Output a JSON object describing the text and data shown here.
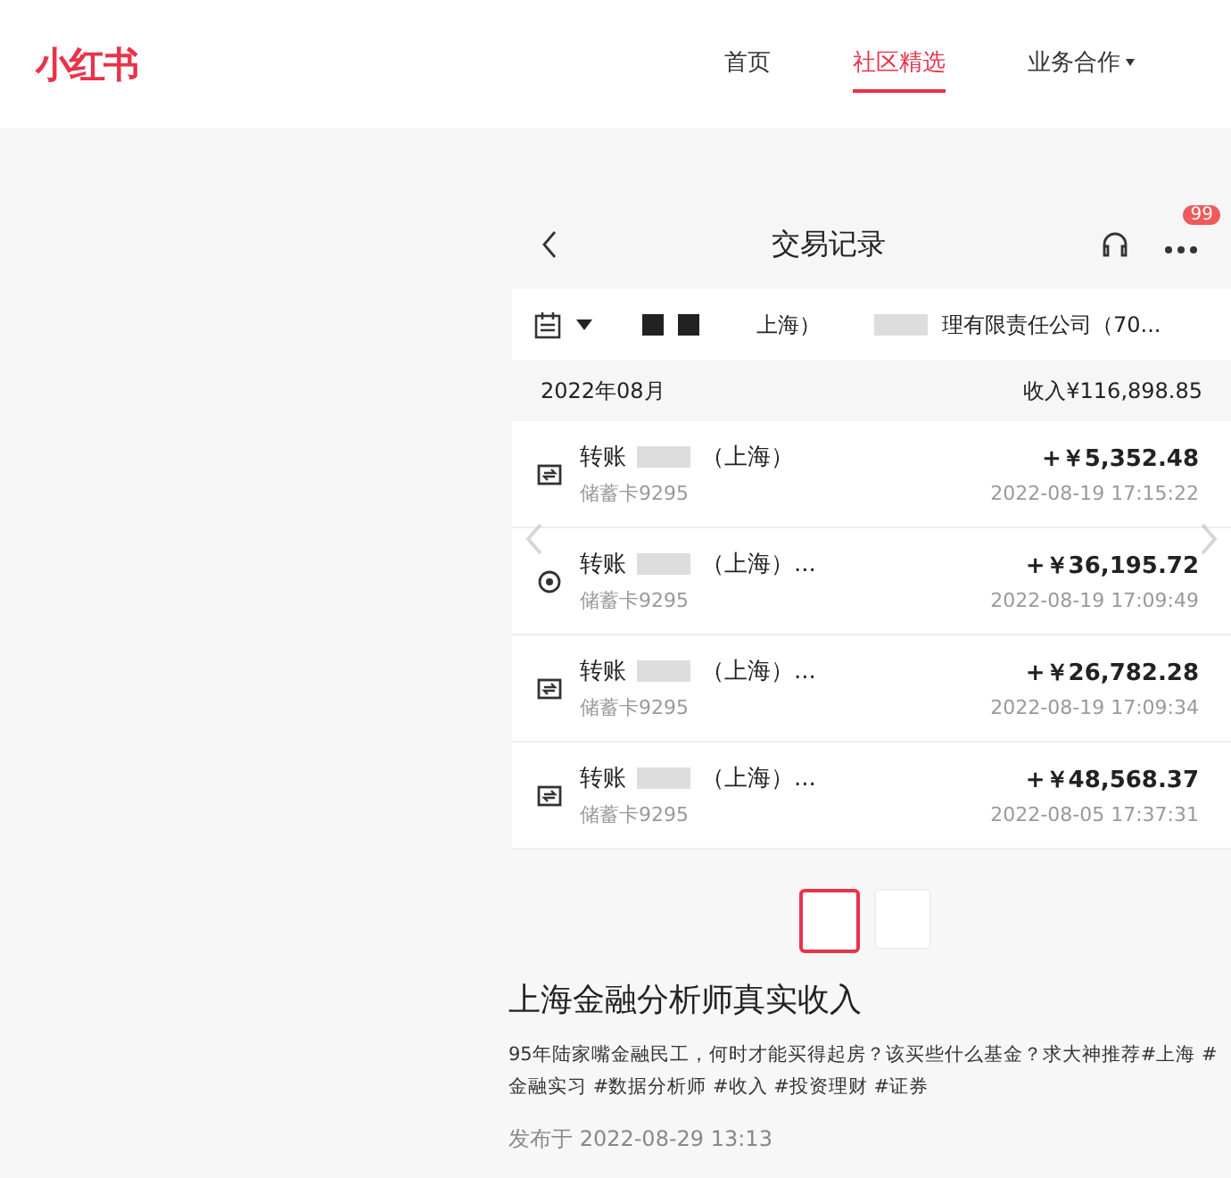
{
  "header": {
    "logo": "小红书",
    "nav": [
      {
        "label": "首页",
        "selected": false,
        "dropdown": false
      },
      {
        "label": "社区精选",
        "selected": true,
        "dropdown": false
      },
      {
        "label": "业务合作",
        "selected": false,
        "dropdown": true
      }
    ]
  },
  "screenshot": {
    "title": "交易记录",
    "badge": "99",
    "filter": {
      "part_1": "上海）",
      "part_2": "理有限责任公司（70..."
    },
    "month": "2022年08月",
    "income": "收入¥116,898.85",
    "rows": [
      {
        "kind": "transfer",
        "label": "转账",
        "detail": "（上海）",
        "card": "储蓄卡9295",
        "amount": "+￥5,352.48",
        "time": "2022-08-19 17:15:22"
      },
      {
        "kind": "circle",
        "label": "转账",
        "detail": "（上海）...",
        "card": "储蓄卡9295",
        "amount": "+￥36,195.72",
        "time": "2022-08-19 17:09:49"
      },
      {
        "kind": "transfer",
        "label": "转账",
        "detail": "（上海）...",
        "card": "储蓄卡9295",
        "amount": "+￥26,782.28",
        "time": "2022-08-19 17:09:34"
      },
      {
        "kind": "transfer",
        "label": "转账",
        "detail": "（上海）...",
        "card": "储蓄卡9295",
        "amount": "+￥48,568.37",
        "time": "2022-08-05 17:37:31"
      }
    ]
  },
  "thumbnails": [
    {
      "selected": true
    },
    {
      "selected": false
    }
  ],
  "post": {
    "title": "上海金融分析师真实收入",
    "body": "95年陆家嘴金融民工，何时才能买得起房？该买些什么基金？求大神推荐#上海 #金融实习 #数据分析师 #收入 #投资理财 #证券",
    "date": "发布于 2022-08-29 13:13"
  }
}
